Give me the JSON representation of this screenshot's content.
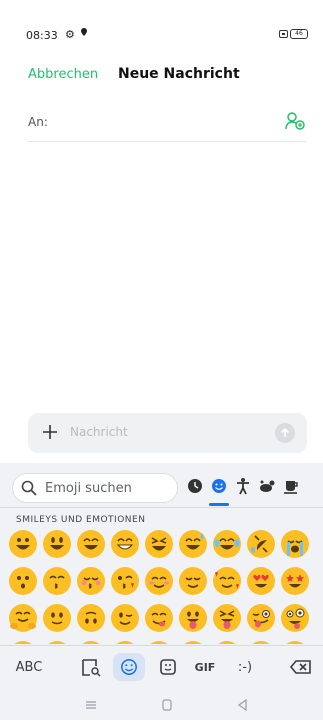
{
  "status": {
    "time": "08:33",
    "battery": "46"
  },
  "header": {
    "cancel_label": "Abbrechen",
    "title": "Neue Nachricht"
  },
  "recipient": {
    "label": "An:"
  },
  "composer": {
    "placeholder": "Nachricht"
  },
  "keyboard": {
    "search_placeholder": "Emoji suchen",
    "section_title": "SMILEYS UND EMOTIONEN",
    "categories": [
      "recent-clock-icon",
      "smileys-icon",
      "people-icon",
      "animals-icon",
      "food-icon"
    ],
    "toolbar": {
      "abc_label": "ABC",
      "gif_label": "GIF",
      "emoticon_label": ":-)"
    },
    "emoji_rows": [
      [
        "grinning",
        "grin-big",
        "grin-eyes",
        "beaming",
        "squint-laugh",
        "sweat-smile",
        "joy",
        "rolling-laugh",
        "crying"
      ],
      [
        "kissing",
        "kissing-smile",
        "kissing-closed",
        "kiss-heart",
        "smile-blush",
        "relieved",
        "hearts-face",
        "heart-eyes",
        "star-struck"
      ],
      [
        "hugging",
        "slight-smile",
        "upside-down",
        "wink",
        "yum",
        "tongue",
        "squint-tongue",
        "zany",
        "crazy"
      ]
    ]
  },
  "colors": {
    "accent": "#21c06a",
    "keyboard_accent": "#1a73e8",
    "emoji": "#fbbf24"
  }
}
